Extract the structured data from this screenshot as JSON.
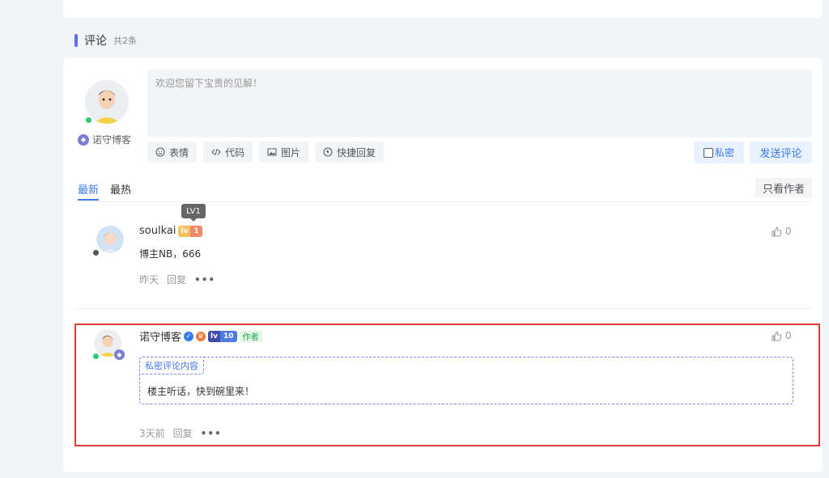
{
  "section": {
    "title": "评论",
    "count": "共2条"
  },
  "composer": {
    "user": "诺守博客",
    "placeholder": "欢迎您留下宝贵的见解！",
    "tools": [
      {
        "icon": "smile-icon",
        "label": "表情"
      },
      {
        "icon": "code-icon",
        "label": "代码"
      },
      {
        "icon": "image-icon",
        "label": "图片"
      },
      {
        "icon": "quick-reply-icon",
        "label": "快捷回复"
      }
    ],
    "private_label": "私密",
    "send_label": "发送评论"
  },
  "tabs": [
    {
      "label": "最新",
      "active": true
    },
    {
      "label": "最热",
      "active": false
    }
  ],
  "only_author_label": "只看作者",
  "comments": [
    {
      "user": "soulkai",
      "level_badge": "1",
      "tooltip": "LV1",
      "text": "博主NB，666",
      "time": "昨天",
      "reply": "回复",
      "likes": "0"
    },
    {
      "user": "诺守博客",
      "level_badge": "10",
      "author_tag": "作者",
      "private_tag": "私密评论内容",
      "text": "楼主听话，快到碗里来！",
      "time": "3天前",
      "reply": "回复",
      "likes": "0"
    }
  ],
  "colors": {
    "accent": "#3a7bef",
    "highlight": "#e53935",
    "online": "#2ecc71"
  }
}
